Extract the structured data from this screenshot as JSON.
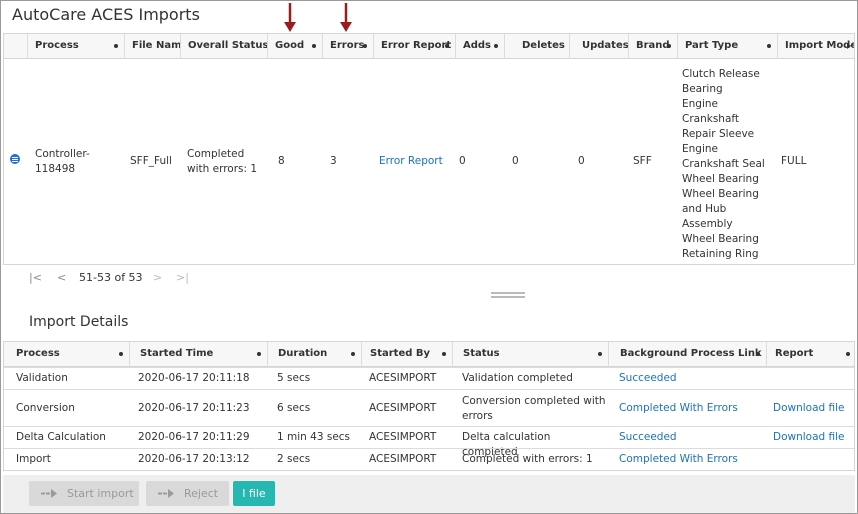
{
  "header": {
    "title": "AutoCare ACES Imports"
  },
  "imports_table": {
    "columns": [
      "Process",
      "File Name",
      "Overall Status",
      "Good",
      "Errors",
      "Error Report",
      "Adds",
      "Deletes",
      "Updates",
      "Brand",
      "Part Type",
      "Import Mode"
    ],
    "row": {
      "process": "Controller-118498",
      "file_name": "SFF_Full",
      "overall_status": "Completed with errors: 1",
      "good": "8",
      "errors": "3",
      "error_report": "Error Report",
      "adds": "0",
      "deletes": "0",
      "updates": "0",
      "brand": "SFF",
      "part_types": [
        "Clutch Release",
        "Bearing",
        "Engine",
        "Crankshaft",
        "Repair Sleeve",
        "Engine",
        "Crankshaft Seal",
        "Wheel Bearing",
        "Wheel Bearing",
        "and Hub",
        "Assembly",
        "Wheel Bearing",
        "Retaining Ring"
      ],
      "import_mode": "FULL"
    },
    "pager": {
      "first": "|<",
      "prev": "<",
      "range": "51-53 of 53",
      "next": ">",
      "last": ">|"
    }
  },
  "details": {
    "title": "Import Details",
    "columns": [
      "Process",
      "Started Time",
      "Duration",
      "Started By",
      "Status",
      "Background Process Link",
      "Report"
    ],
    "rows": [
      {
        "process": "Validation",
        "started": "2020-06-17 20:11:18",
        "duration": "5 secs",
        "by": "ACESIMPORT",
        "status": "Validation completed",
        "link": "Succeeded",
        "report": ""
      },
      {
        "process": "Conversion",
        "started": "2020-06-17 20:11:23",
        "duration": "6 secs",
        "by": "ACESIMPORT",
        "status": "Conversion completed with errors",
        "link": "Completed With Errors",
        "report": "Download file"
      },
      {
        "process": "Delta Calculation",
        "started": "2020-06-17 20:11:29",
        "duration": "1 min 43 secs",
        "by": "ACESIMPORT",
        "status": "Delta calculation completed",
        "link": "Succeeded",
        "report": "Download file"
      },
      {
        "process": "Import",
        "started": "2020-06-17 20:13:12",
        "duration": "2 secs",
        "by": "ACESIMPORT",
        "status": "Completed with errors: 1",
        "link": "Completed With Errors",
        "report": ""
      }
    ]
  },
  "footer": {
    "start_import": "Start import",
    "reject": "Reject",
    "file": "l file"
  },
  "colors": {
    "link": "#1a73b8",
    "accent_button": "#26b8b0",
    "annotation_arrow": "#9b1c1c",
    "expander": "#1f6fd1"
  }
}
